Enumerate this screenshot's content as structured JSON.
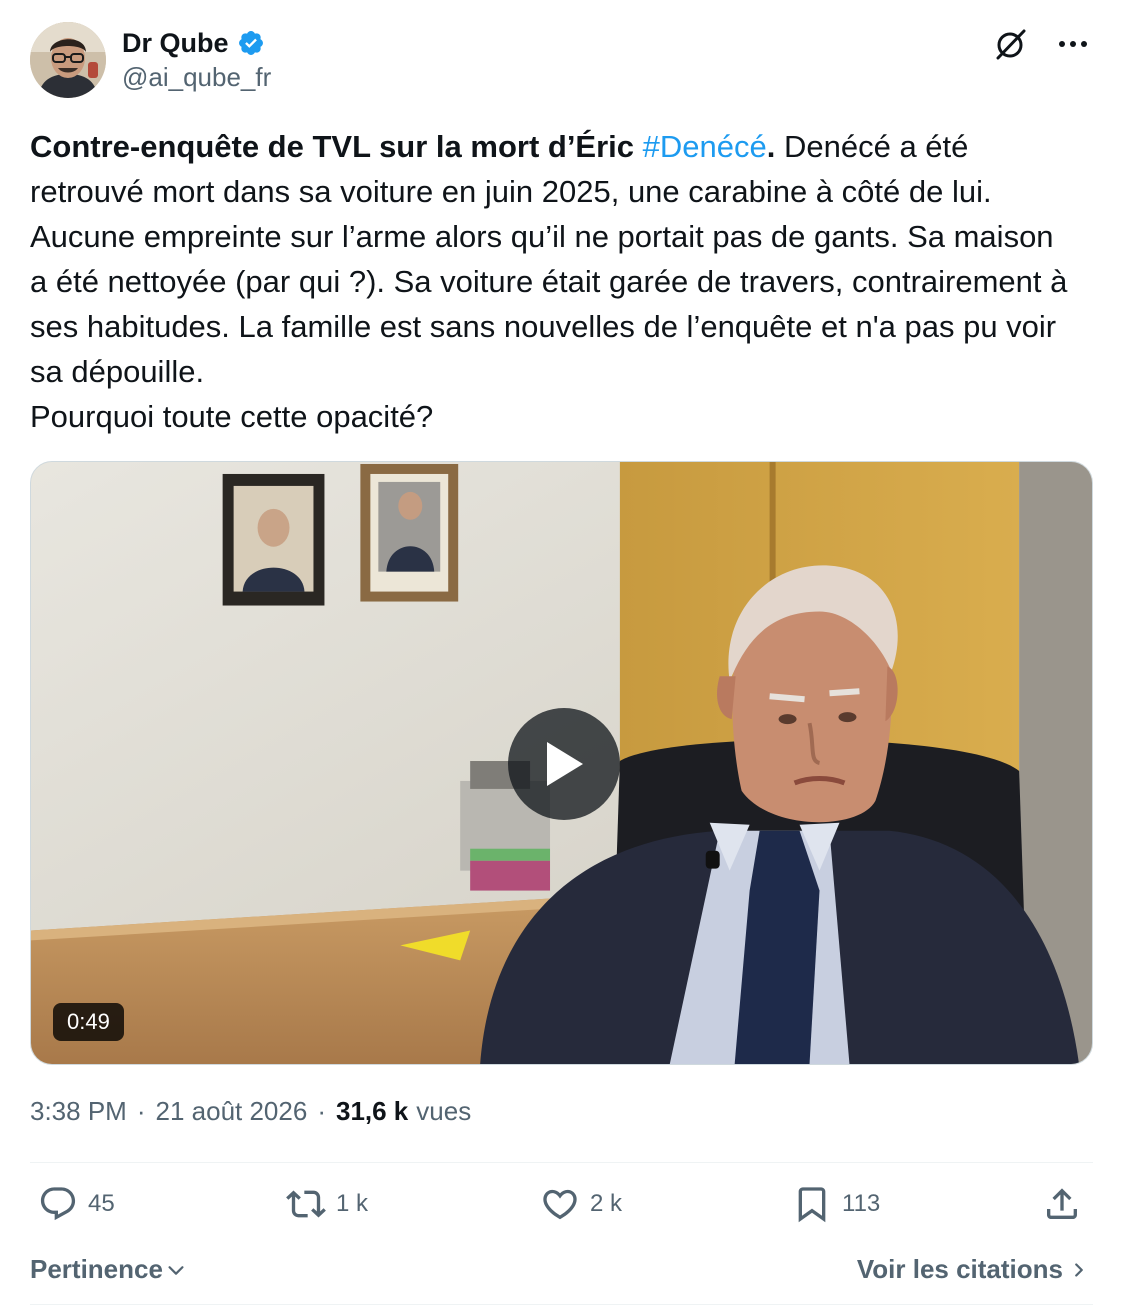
{
  "author": {
    "name": "Dr Qube",
    "handle": "@ai_qube_fr",
    "verified": true,
    "verified_color": "#1d9bf0"
  },
  "post": {
    "bold_text": "Contre-enquête de TVL sur la mort d’Éric ",
    "hashtag": "#Denécé",
    "bold_period": ".",
    "text_after": " Denécé a été retrouvé mort dans sa voiture en juin 2025, une carabine à côté de lui. Aucune empreinte sur l’arme alors qu’il ne portait pas de gants. Sa maison a été nettoyée (par qui ?). Sa voiture était garée de travers, contrairement à ses habitudes. La famille est sans nouvelles de l’enquête et n'a pas pu voir sa dépouille.",
    "last_line": "Pourquoi toute cette opacité?"
  },
  "media": {
    "duration": "0:49"
  },
  "meta": {
    "time": "3:38 PM",
    "date": "21 août 2026",
    "views_count": "31,6 k",
    "views_label": "vues",
    "separator": "·"
  },
  "actions": {
    "replies": "45",
    "reposts": "1 k",
    "likes": "2 k",
    "bookmarks": "113"
  },
  "footer": {
    "sort_label": "Pertinence",
    "quotes_label": "Voir les citations"
  },
  "colors": {
    "text": "#0f1419",
    "secondary": "#536471",
    "accent": "#1d9bf0",
    "border": "#eff3f4"
  },
  "icons": [
    "verified-badge-icon",
    "grok-icon",
    "more-icon",
    "play-icon",
    "reply-icon",
    "repost-icon",
    "like-icon",
    "bookmark-icon",
    "share-icon",
    "chevron-down-icon",
    "chevron-right-icon"
  ]
}
